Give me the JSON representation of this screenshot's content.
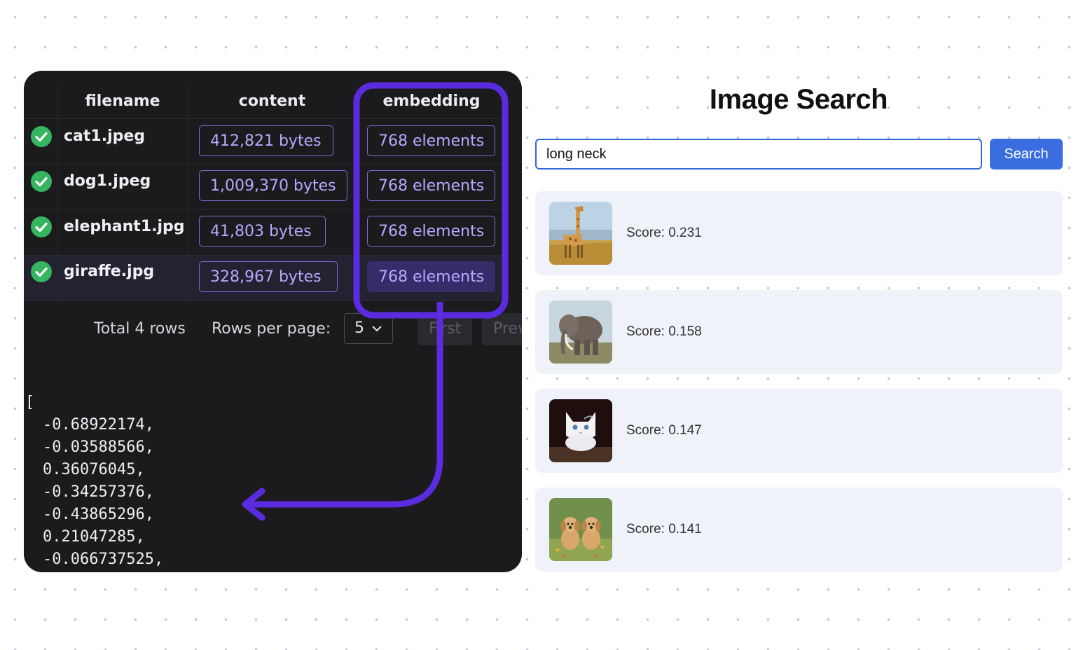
{
  "table": {
    "columns": [
      "filename",
      "content",
      "embedding"
    ],
    "rows": [
      {
        "filename": "cat1.jpeg",
        "content": "412,821 bytes",
        "embedding": "768 elements"
      },
      {
        "filename": "dog1.jpeg",
        "content": "1,009,370 bytes",
        "embedding": "768 elements"
      },
      {
        "filename": "elephant1.jpg",
        "content": "41,803 bytes",
        "embedding": "768 elements"
      },
      {
        "filename": "giraffe.jpg",
        "content": "328,967 bytes",
        "embedding": "768 elements"
      }
    ],
    "total_label": "Total 4 rows",
    "rows_per_page_label": "Rows per page:",
    "rows_per_page_value": "5",
    "pagination": {
      "first": "First",
      "prev": "Prev"
    }
  },
  "vector": {
    "open": "[",
    "values": [
      "-0.68922174,",
      "-0.03588566,",
      "0.36076045,",
      "-0.34257376,",
      "-0.43865296,",
      "0.21047285,",
      "-0.066737525,"
    ]
  },
  "search": {
    "title": "Image Search",
    "query": "long neck",
    "button_label": "Search",
    "results": [
      {
        "image": "giraffe-image",
        "score_label": "Score: 0.231"
      },
      {
        "image": "elephant-image",
        "score_label": "Score: 0.158"
      },
      {
        "image": "cat-image",
        "score_label": "Score: 0.147"
      },
      {
        "image": "dog-image",
        "score_label": "Score: 0.141"
      }
    ]
  },
  "colors": {
    "highlight": "#5b2be0",
    "check": "#35b560",
    "search_button": "#3a6ee0",
    "pill_text": "#b6a9ff"
  }
}
